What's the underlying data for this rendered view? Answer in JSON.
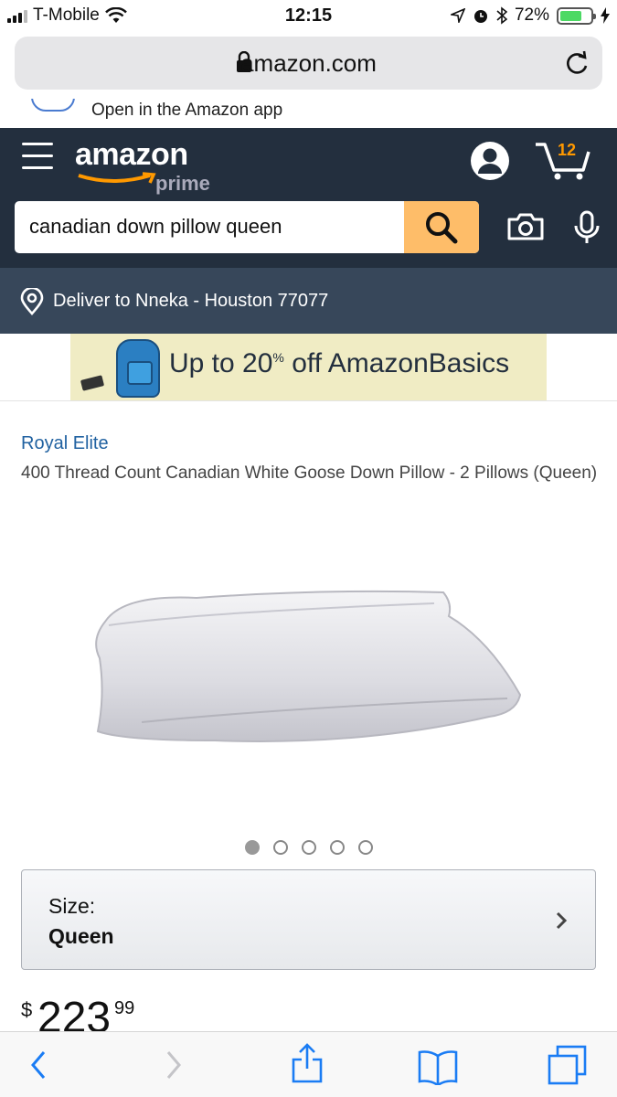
{
  "status_bar": {
    "carrier": "T-Mobile",
    "time": "12:15",
    "battery": "72%",
    "battery_level": 0.72,
    "icons": [
      "signal-icon",
      "wifi-icon",
      "location-icon",
      "alarm-icon",
      "bluetooth-icon",
      "battery-icon",
      "charging-icon"
    ]
  },
  "browser": {
    "url": "amazon.com"
  },
  "app_banner": {
    "label": "Open in the Amazon app"
  },
  "header": {
    "logo_word": "amazon",
    "logo_prime": "prime",
    "cart_count": "12",
    "search_query": "canadian down pillow queen"
  },
  "deliver": {
    "text": "Deliver to Nneka - Houston 77077"
  },
  "promo": {
    "text_a": "Up to 20",
    "text_pct": "%",
    "text_b": " off AmazonBasics"
  },
  "product": {
    "brand": "Royal Elite",
    "title": "400 Thread Count Canadian White Goose Down Pillow - 2 Pillows (Queen)",
    "image_count": 5,
    "active_image": 1,
    "size_label": "Size:",
    "size_value": "Queen",
    "price_currency": "$",
    "price_whole": "223",
    "price_fraction": "99"
  },
  "colors": {
    "header_bg": "#232f3e",
    "deliver_bg": "#37475a",
    "search_button": "#febd69",
    "link": "#2162a1",
    "ios_blue": "#1a7cf4",
    "cart_count": "#ff9900"
  }
}
